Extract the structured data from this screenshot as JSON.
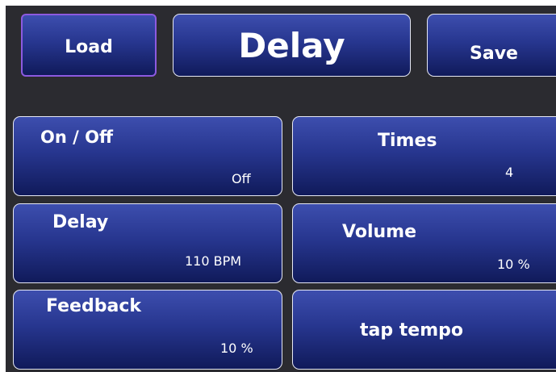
{
  "header": {
    "load_label": "Load",
    "title": "Delay",
    "save_label": "Save"
  },
  "controls": {
    "on_off": {
      "label": "On / Off",
      "value": "Off"
    },
    "times": {
      "label": "Times",
      "value": "4"
    },
    "delay": {
      "label": "Delay",
      "value": "110 BPM"
    },
    "volume": {
      "label": "Volume",
      "value": "10 %"
    },
    "feedback": {
      "label": "Feedback",
      "value": "10 %"
    },
    "tap_tempo": {
      "label": "tap tempo"
    }
  },
  "colors": {
    "background": "#2b2b30",
    "button_top": "#3d4eae",
    "button_bottom": "#101a5a",
    "selected_border": "#8d5ae0",
    "text": "#ffffff"
  }
}
